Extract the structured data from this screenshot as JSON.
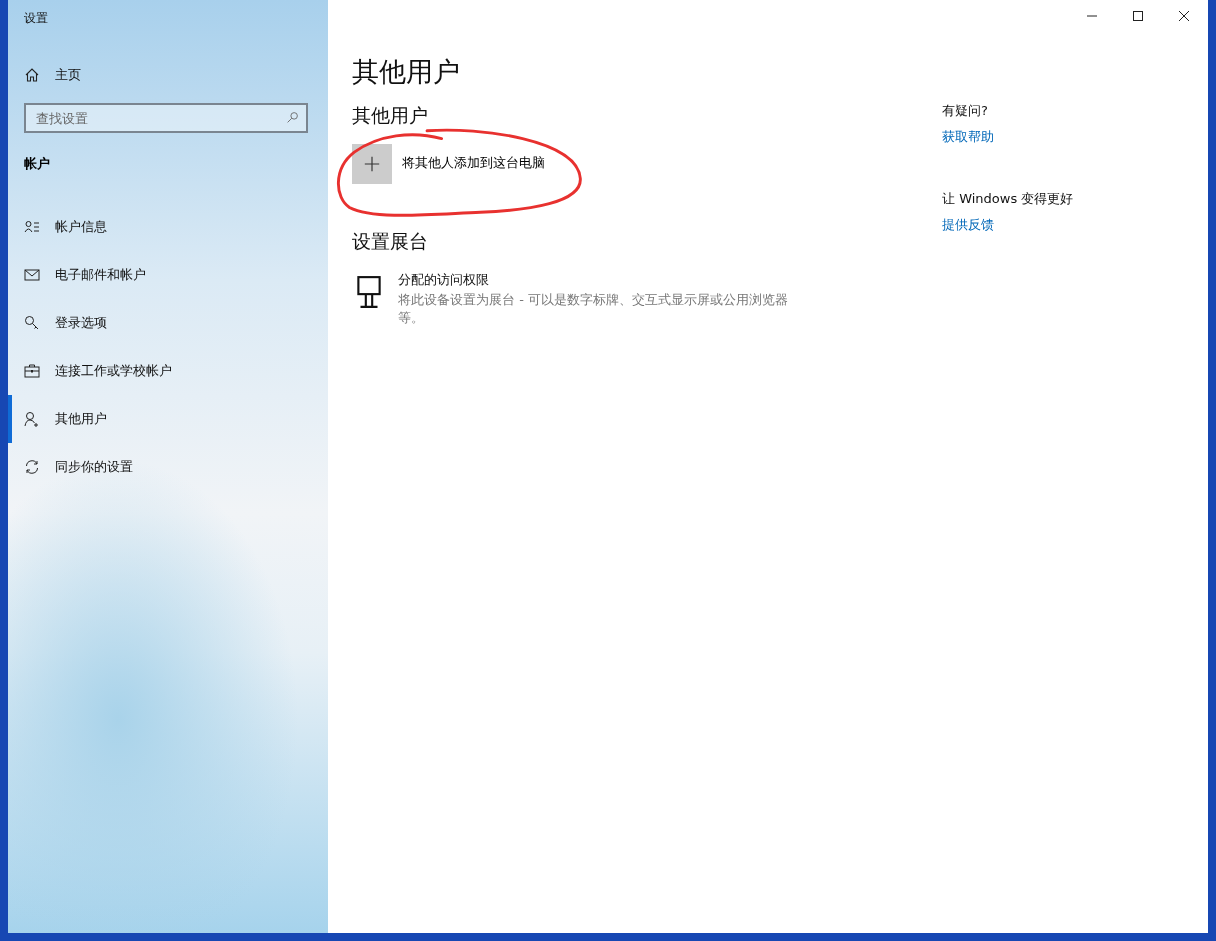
{
  "window": {
    "title": "设置"
  },
  "sidebar": {
    "home": "主页",
    "search": {
      "placeholder": "查找设置"
    },
    "section": "帐户",
    "items": [
      {
        "label": "帐户信息",
        "kind": "info",
        "selected": false
      },
      {
        "label": "电子邮件和帐户",
        "kind": "mail",
        "selected": false
      },
      {
        "label": "登录选项",
        "kind": "key",
        "selected": false
      },
      {
        "label": "连接工作或学校帐户",
        "kind": "work",
        "selected": false
      },
      {
        "label": "其他用户",
        "kind": "person",
        "selected": true
      },
      {
        "label": "同步你的设置",
        "kind": "sync",
        "selected": false
      }
    ]
  },
  "main": {
    "title": "其他用户",
    "group_heading": "其他用户",
    "add_button": {
      "label": "将其他人添加到这台电脑",
      "annotated": true
    },
    "kiosk_heading": "设置展台",
    "kiosk": {
      "title": "分配的访问权限",
      "description": "将此设备设置为展台 - 可以是数字标牌、交互式显示屏或公用浏览器等。"
    }
  },
  "aside": [
    {
      "heading": "有疑问?",
      "link": "获取帮助"
    },
    {
      "heading": "让 Windows 变得更好",
      "link": "提供反馈"
    }
  ]
}
